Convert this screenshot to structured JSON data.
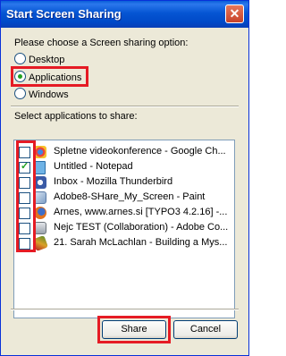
{
  "window": {
    "title": "Start Screen Sharing",
    "close_glyph": "✕"
  },
  "prompt_option": "Please choose a Screen sharing option:",
  "options": [
    {
      "label": "Desktop",
      "selected": false
    },
    {
      "label": "Applications",
      "selected": true
    },
    {
      "label": "Windows",
      "selected": false
    }
  ],
  "apps_label": "Select applications to share:",
  "apps": [
    {
      "label": "Spletne videokonference - Google Ch...",
      "checked": false,
      "icon": "chrome-icon",
      "color": "#3f86e2"
    },
    {
      "label": "Untitled - Notepad",
      "checked": true,
      "icon": "notepad-icon",
      "color": "#6fb3e6"
    },
    {
      "label": "Inbox - Mozilla Thunderbird",
      "checked": false,
      "icon": "thunderbird-icon",
      "color": "#3a5aa6"
    },
    {
      "label": "Adobe8-SHare_My_Screen - Paint",
      "checked": false,
      "icon": "paint-icon",
      "color": "#9bb6d8"
    },
    {
      "label": "Arnes, www.arnes.si [TYPO3 4.2.16] -...",
      "checked": false,
      "icon": "firefox-icon",
      "color": "#e3731d"
    },
    {
      "label": "Nejc TEST (Collaboration) - Adobe Co...",
      "checked": false,
      "icon": "connect-icon",
      "color": "#9aa3ad"
    },
    {
      "label": "21. Sarah McLachlan - Building a Mys...",
      "checked": false,
      "icon": "winamp-icon",
      "color": "#d9a12a"
    }
  ],
  "buttons": {
    "share": "Share",
    "cancel": "Cancel"
  },
  "colors": {
    "highlight": "#e51b24",
    "titlebar": "#0555d3"
  }
}
